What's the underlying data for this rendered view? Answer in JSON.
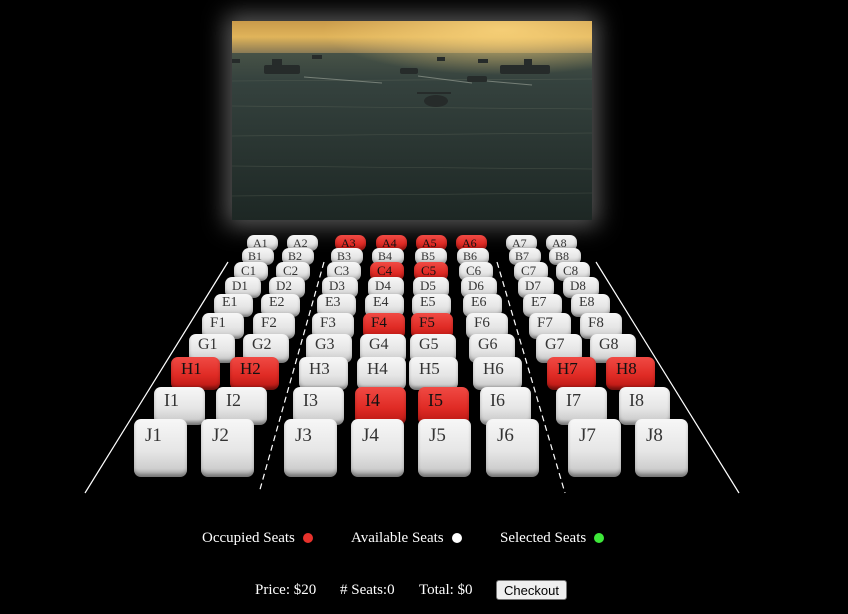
{
  "screen": {
    "description_icon": "movie-screen-image"
  },
  "rows": [
    {
      "row": "A",
      "seats": [
        {
          "id": "A1",
          "occupied": false
        },
        {
          "id": "A2",
          "occupied": false
        },
        {
          "id": "A3",
          "occupied": true
        },
        {
          "id": "A4",
          "occupied": true
        },
        {
          "id": "A5",
          "occupied": true
        },
        {
          "id": "A6",
          "occupied": true
        },
        {
          "id": "A7",
          "occupied": false
        },
        {
          "id": "A8",
          "occupied": false
        }
      ]
    },
    {
      "row": "B",
      "seats": [
        {
          "id": "B1",
          "occupied": false
        },
        {
          "id": "B2",
          "occupied": false
        },
        {
          "id": "B3",
          "occupied": false
        },
        {
          "id": "B4",
          "occupied": false
        },
        {
          "id": "B5",
          "occupied": false
        },
        {
          "id": "B6",
          "occupied": false
        },
        {
          "id": "B7",
          "occupied": false
        },
        {
          "id": "B8",
          "occupied": false
        }
      ]
    },
    {
      "row": "C",
      "seats": [
        {
          "id": "C1",
          "occupied": false
        },
        {
          "id": "C2",
          "occupied": false
        },
        {
          "id": "C3",
          "occupied": false
        },
        {
          "id": "C4",
          "occupied": true
        },
        {
          "id": "C5",
          "occupied": true
        },
        {
          "id": "C6",
          "occupied": false
        },
        {
          "id": "C7",
          "occupied": false
        },
        {
          "id": "C8",
          "occupied": false
        }
      ]
    },
    {
      "row": "D",
      "seats": [
        {
          "id": "D1",
          "occupied": false
        },
        {
          "id": "D2",
          "occupied": false
        },
        {
          "id": "D3",
          "occupied": false
        },
        {
          "id": "D4",
          "occupied": false
        },
        {
          "id": "D5",
          "occupied": false
        },
        {
          "id": "D6",
          "occupied": false
        },
        {
          "id": "D7",
          "occupied": false
        },
        {
          "id": "D8",
          "occupied": false
        }
      ]
    },
    {
      "row": "E",
      "seats": [
        {
          "id": "E1",
          "occupied": false
        },
        {
          "id": "E2",
          "occupied": false
        },
        {
          "id": "E3",
          "occupied": false
        },
        {
          "id": "E4",
          "occupied": false
        },
        {
          "id": "E5",
          "occupied": false
        },
        {
          "id": "E6",
          "occupied": false
        },
        {
          "id": "E7",
          "occupied": false
        },
        {
          "id": "E8",
          "occupied": false
        }
      ]
    },
    {
      "row": "F",
      "seats": [
        {
          "id": "F1",
          "occupied": false
        },
        {
          "id": "F2",
          "occupied": false
        },
        {
          "id": "F3",
          "occupied": false
        },
        {
          "id": "F4",
          "occupied": true
        },
        {
          "id": "F5",
          "occupied": true
        },
        {
          "id": "F6",
          "occupied": false
        },
        {
          "id": "F7",
          "occupied": false
        },
        {
          "id": "F8",
          "occupied": false
        }
      ]
    },
    {
      "row": "G",
      "seats": [
        {
          "id": "G1",
          "occupied": false
        },
        {
          "id": "G2",
          "occupied": false
        },
        {
          "id": "G3",
          "occupied": false
        },
        {
          "id": "G4",
          "occupied": false
        },
        {
          "id": "G5",
          "occupied": false
        },
        {
          "id": "G6",
          "occupied": false
        },
        {
          "id": "G7",
          "occupied": false
        },
        {
          "id": "G8",
          "occupied": false
        }
      ]
    },
    {
      "row": "H",
      "seats": [
        {
          "id": "H1",
          "occupied": true
        },
        {
          "id": "H2",
          "occupied": true
        },
        {
          "id": "H3",
          "occupied": false
        },
        {
          "id": "H4",
          "occupied": false
        },
        {
          "id": "H5",
          "occupied": false
        },
        {
          "id": "H6",
          "occupied": false
        },
        {
          "id": "H7",
          "occupied": true
        },
        {
          "id": "H8",
          "occupied": true
        }
      ]
    },
    {
      "row": "I",
      "seats": [
        {
          "id": "I1",
          "occupied": false
        },
        {
          "id": "I2",
          "occupied": false
        },
        {
          "id": "I3",
          "occupied": false
        },
        {
          "id": "I4",
          "occupied": true
        },
        {
          "id": "I5",
          "occupied": true
        },
        {
          "id": "I6",
          "occupied": false
        },
        {
          "id": "I7",
          "occupied": false
        },
        {
          "id": "I8",
          "occupied": false
        }
      ]
    },
    {
      "row": "J",
      "seats": [
        {
          "id": "J1",
          "occupied": false
        },
        {
          "id": "J2",
          "occupied": false
        },
        {
          "id": "J3",
          "occupied": false
        },
        {
          "id": "J4",
          "occupied": false
        },
        {
          "id": "J5",
          "occupied": false
        },
        {
          "id": "J6",
          "occupied": false
        },
        {
          "id": "J7",
          "occupied": false
        },
        {
          "id": "J8",
          "occupied": false
        }
      ]
    }
  ],
  "legend": {
    "occupied_label": "Occupied Seats",
    "available_label": "Available Seats",
    "selected_label": "Selected Seats",
    "occupied_color": "#e8322c",
    "available_color": "#ffffff",
    "selected_color": "#3ee83a"
  },
  "summary": {
    "price": "Price: $20",
    "seats": "# Seats:0",
    "total": "Total: $0",
    "checkout_label": "Checkout"
  }
}
